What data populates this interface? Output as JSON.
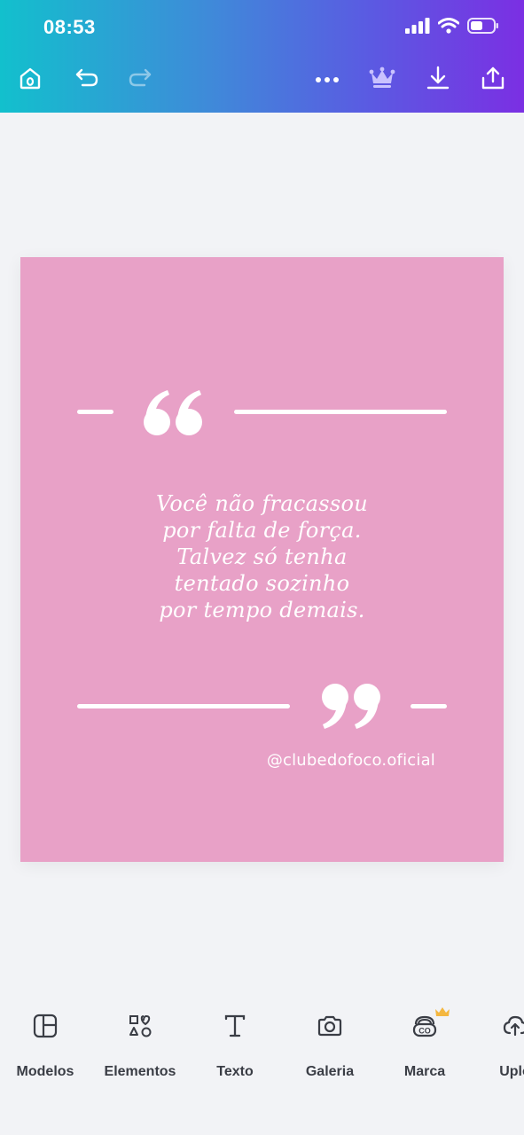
{
  "status_bar": {
    "time": "08:53",
    "icons": [
      "cellular-signal-icon",
      "wifi-icon",
      "battery-icon"
    ]
  },
  "toolbar": {
    "items": [
      "home-icon",
      "undo-icon",
      "redo-icon",
      "more-options-icon",
      "premium-crown-icon",
      "download-icon",
      "share-icon"
    ],
    "accent_color": "#c9c2ff"
  },
  "design": {
    "background_color": "#e8a1c7",
    "quote_lines": [
      "Você não fracassou",
      "por falta de força.",
      "Talvez só tenha",
      "tentado sozinho",
      "por tempo demais."
    ],
    "handle": "@clubedofoco.oficial",
    "open_quote_mark": "66",
    "close_quote_mark": "99"
  },
  "bottom_nav": {
    "items": [
      {
        "label": "Modelos",
        "icon": "templates-icon"
      },
      {
        "label": "Elementos",
        "icon": "elements-icon"
      },
      {
        "label": "Texto",
        "icon": "text-icon"
      },
      {
        "label": "Galeria",
        "icon": "camera-icon"
      },
      {
        "label": "Marca",
        "icon": "brand-icon",
        "premium": true
      },
      {
        "label": "Uplo",
        "icon": "upload-cloud-icon"
      }
    ],
    "premium_color": "#f4b740"
  }
}
